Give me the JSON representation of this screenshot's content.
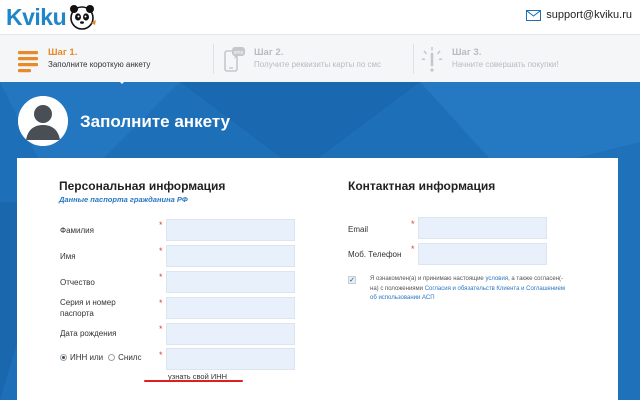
{
  "header": {
    "logo_text": "Kviku",
    "support_email": "support@kviku.ru"
  },
  "steps": [
    {
      "title": "Шаг 1.",
      "desc": "Заполните короткую анкету",
      "state": "active"
    },
    {
      "title": "Шаг 2.",
      "desc": "Получите реквизиты карты по смс",
      "state": "inactive"
    },
    {
      "title": "Шаг 3.",
      "desc": "Начните совершать покупки!",
      "state": "inactive"
    }
  ],
  "page_title": "Заполните анкету",
  "personal": {
    "title": "Персональная информация",
    "subtitle": "Данные паспорта гражданина РФ",
    "fields": [
      {
        "label": "Фамилия",
        "value": ""
      },
      {
        "label": "Имя",
        "value": ""
      },
      {
        "label": "Отчество",
        "value": ""
      },
      {
        "label": "Серия и номер паспорта",
        "value": ""
      },
      {
        "label": "Дата рождения",
        "value": ""
      }
    ],
    "id_choice": {
      "options": [
        "ИНН или",
        "Снилс"
      ],
      "selected": "ИНН или",
      "value": ""
    },
    "inn_link": "узнать свой ИНН"
  },
  "contact": {
    "title": "Контактная информация",
    "fields": [
      {
        "label": "Email",
        "value": ""
      },
      {
        "label": "Моб. Телефон",
        "value": ""
      }
    ],
    "agreement": {
      "checked": true,
      "text_1": "Я ознакомлен(а) и принимаю настоящие ",
      "link_1": "условия",
      "text_2": ", а также согласен(-на) с положениями ",
      "link_2": "Согласия и обязательств Клиента и Соглашением об использовании АСП"
    }
  },
  "required_mark": "*",
  "colors": {
    "brand_blue": "#1e86c9",
    "band_blue": "#1d6fb8",
    "step_active": "#e8892a",
    "input_bg": "#e8f0fb",
    "highlight_red": "#e01e1e"
  }
}
